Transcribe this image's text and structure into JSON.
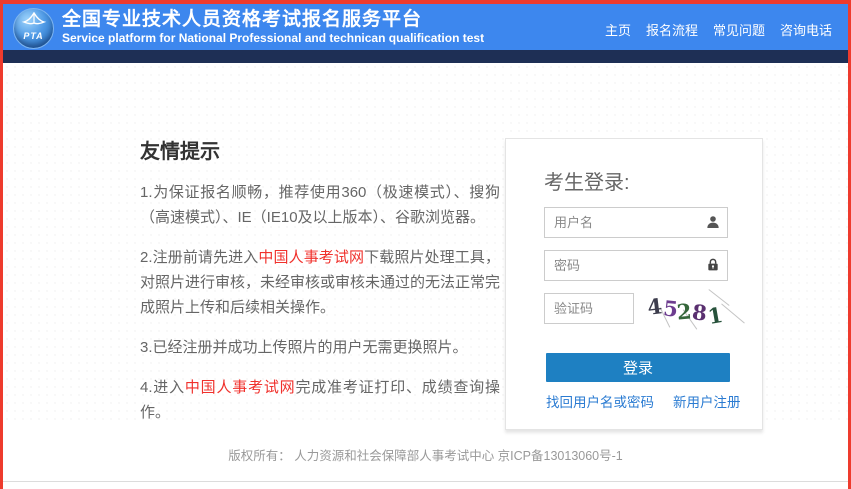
{
  "header": {
    "logo_text": "PTA",
    "title": "全国专业技术人员资格考试报名服务平台",
    "subtitle": "Service platform for National Professional and technican qualification test",
    "nav": [
      {
        "label": "主页"
      },
      {
        "label": "报名流程"
      },
      {
        "label": "常见问题"
      },
      {
        "label": "咨询电话"
      }
    ]
  },
  "tips": {
    "heading": "友情提示",
    "items": [
      {
        "pre": "1.为保证报名顺畅，推荐使用360（极速模式）、搜狗（高速模式）、IE（IE10及以上版本）、谷歌浏览器。",
        "link": "",
        "post": ""
      },
      {
        "pre": "2.注册前请先进入",
        "link": "中国人事考试网",
        "post": "下载照片处理工具，对照片进行审核，未经审核或审核未通过的无法正常完成照片上传和后续相关操作。"
      },
      {
        "pre": "3.已经注册并成功上传照片的用户无需更换照片。",
        "link": "",
        "post": ""
      },
      {
        "pre": "4.进入",
        "link": "中国人事考试网",
        "post": "完成准考证打印、成绩查询操作。"
      }
    ]
  },
  "login": {
    "title": "考生登录:",
    "username_placeholder": "用户名",
    "password_placeholder": "密码",
    "captcha_placeholder": "验证码",
    "captcha_value": "45281",
    "captcha": {
      "digits": [
        {
          "char": "4",
          "color": "#3d3d4d"
        },
        {
          "char": "5",
          "color": "#6d3d8f"
        },
        {
          "char": "2",
          "color": "#35663a"
        },
        {
          "char": "8",
          "color": "#5a3070"
        },
        {
          "char": "1",
          "color": "#27523b"
        }
      ]
    },
    "login_button": "登录",
    "forgot_link": "找回用户名或密码",
    "register_link": "新用户注册"
  },
  "footer": {
    "copyright": "版权所有： 人力资源和社会保障部人事考试中心 京ICP备13013060号-1"
  },
  "colors": {
    "header_blue": "#3d87ee",
    "subbar_navy": "#1e2f55",
    "border_red": "#ee3b2d",
    "button_blue": "#1e80c2",
    "link_blue": "#2a7bd2",
    "tip_link_red": "#f0312c"
  }
}
